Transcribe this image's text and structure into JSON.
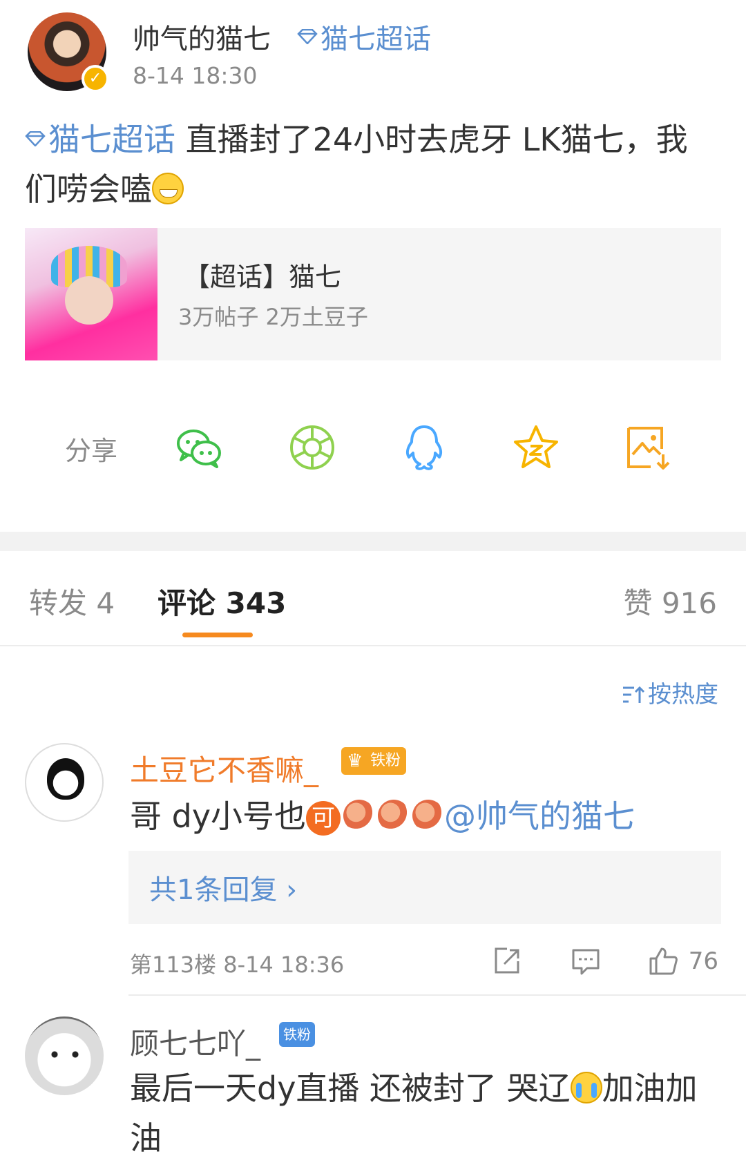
{
  "post": {
    "author_name": "帅气的猫七",
    "supertopic_tag": "猫七超话",
    "time": "8-14 18:30",
    "body_topic": "猫七超话",
    "body_text": "直播封了24小时去虎牙  LK猫七，我们唠会嗑"
  },
  "topic_card": {
    "title": "【超话】猫七",
    "stats": "3万帖子 2万土豆子"
  },
  "share": {
    "label": "分享",
    "icons": [
      "wechat-icon",
      "moments-icon",
      "qq-icon",
      "qzone-icon",
      "save-image-icon"
    ]
  },
  "tabs": {
    "repost": "转发 4",
    "comments": "评论 343",
    "likes": "赞 916"
  },
  "sort": {
    "label": "按热度"
  },
  "comments": [
    {
      "name": "土豆它不香嘛_",
      "badge": "铁粉",
      "text": "哥 dy小号也",
      "ke": "可",
      "mention": "@帅气的猫七",
      "reply_summary": "共1条回复 ›",
      "meta": "第113楼 8-14 18:36",
      "like_count": "76"
    },
    {
      "name": "顾七七吖_",
      "badge": "铁粉",
      "text": "最后一天dy直播 还被封了 哭辽",
      "text_end": "加油加油"
    }
  ],
  "colors": {
    "link_blue": "#5b8fd0",
    "accent_orange": "#f68a1f",
    "meta_gray": "#8a8a8a"
  }
}
